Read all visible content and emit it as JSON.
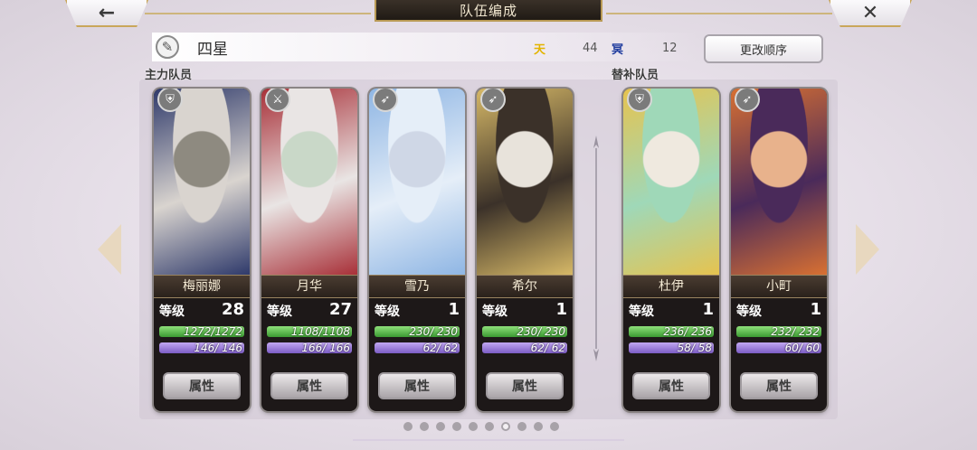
{
  "header": {
    "back_icon": "←",
    "close_icon": "✕",
    "title": "队伍编成"
  },
  "team": {
    "name": "四星",
    "edit_icon": "✎",
    "stat1_badge": "天",
    "stat1_value": "44",
    "stat2_badge": "冥",
    "stat2_value": "12",
    "reorder_label": "更改顺序",
    "main_label": "主力队员",
    "sub_label": "替补队员"
  },
  "colors": {
    "stat1": "#e3b400",
    "stat2": "#1f3c9e"
  },
  "cards": [
    {
      "name": "梅丽娜",
      "level_label": "等级",
      "level": "28",
      "hp": "1272/1272",
      "mp": "146/ 146",
      "attr_label": "属性",
      "job_icon": "shield-icon",
      "palette": [
        "#d9d4cf",
        "#2f3a6b",
        "#8e8a80"
      ]
    },
    {
      "name": "月华",
      "level_label": "等级",
      "level": "27",
      "hp": "1108/1108",
      "mp": "166/ 166",
      "attr_label": "属性",
      "job_icon": "sword-icon",
      "palette": [
        "#e9e5e4",
        "#a83038",
        "#c9d8c8"
      ]
    },
    {
      "name": "雪乃",
      "level_label": "等级",
      "level": "1",
      "hp": "230/ 230",
      "mp": "62/ 62",
      "attr_label": "属性",
      "job_icon": "bow-icon",
      "palette": [
        "#e5eef8",
        "#8fb6e4",
        "#cfd7e6"
      ]
    },
    {
      "name": "希尔",
      "level_label": "等级",
      "level": "1",
      "hp": "230/ 230",
      "mp": "62/ 62",
      "attr_label": "属性",
      "job_icon": "bow-icon",
      "palette": [
        "#3b3129",
        "#d6b867",
        "#e8e3db"
      ]
    },
    {
      "name": "杜伊",
      "level_label": "等级",
      "level": "1",
      "hp": "236/ 236",
      "mp": "58/ 58",
      "attr_label": "属性",
      "job_icon": "shield-icon",
      "palette": [
        "#9fd8b8",
        "#e6c34f",
        "#efe9df"
      ]
    },
    {
      "name": "小町",
      "level_label": "等级",
      "level": "1",
      "hp": "232/ 232",
      "mp": "60/ 60",
      "attr_label": "属性",
      "job_icon": "bow-icon",
      "palette": [
        "#4a2a5a",
        "#d87032",
        "#e8b28c"
      ]
    }
  ],
  "pagination": {
    "total": 10,
    "active": 7
  }
}
